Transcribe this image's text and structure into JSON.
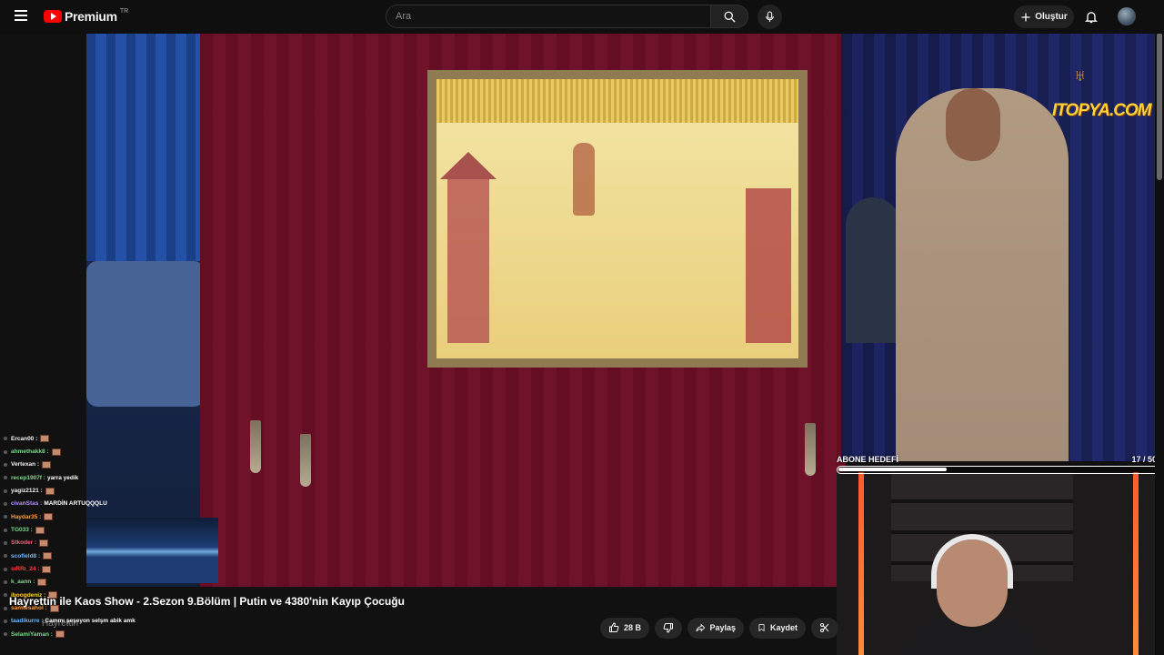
{
  "header": {
    "logo_text": "Premium",
    "region": "TR",
    "search_placeholder": "Ara",
    "create_label": "Oluştur",
    "icons": [
      "menu-icon",
      "search-icon",
      "mic-icon",
      "plus-icon",
      "bell-icon"
    ]
  },
  "overlay": {
    "brand": "ITOPYA.COM",
    "sub_goal": {
      "label": "ABONE HEDEFİ",
      "current": 17,
      "target": 50,
      "count_text": "17  / 50"
    }
  },
  "chat": [
    {
      "user": "Ercan00 :",
      "message": "",
      "color": "#f2f2f2"
    },
    {
      "user": "ahmethakk8 :",
      "message": "",
      "color": "#7cd88a"
    },
    {
      "user": "Vertexan :",
      "message": "",
      "color": "#f2f2f2"
    },
    {
      "user": "recep1907f :",
      "message": "yarra yedik",
      "color": "#7cd88a"
    },
    {
      "user": "yagiz2121 :",
      "message": "",
      "color": "#f2f2f2"
    },
    {
      "user": "civanStas :",
      "message": "MARDİN ARTUQQQLU",
      "color": "#b88cff"
    },
    {
      "user": "Haydar35 :",
      "message": "",
      "color": "#ff9e3d"
    },
    {
      "user": "TG033 :",
      "message": "",
      "color": "#7cd88a"
    },
    {
      "user": "Stkoder :",
      "message": "",
      "color": "#ff5a7a"
    },
    {
      "user": "scofield8 :",
      "message": "",
      "color": "#6fb7ff"
    },
    {
      "user": "sıRRı_24 :",
      "message": "",
      "color": "#ff3b3b"
    },
    {
      "user": "k_aann :",
      "message": "",
      "color": "#7cd88a"
    },
    {
      "user": "iboogdeniz :",
      "message": "",
      "color": "#ffd23a"
    },
    {
      "user": "samtesahol :",
      "message": "",
      "color": "#ff9e3d"
    },
    {
      "user": "taadikurre :",
      "message": "Cammı şeşeyon selşm abik amk",
      "color": "#6fb7ff"
    },
    {
      "user": "SelamiYaman :",
      "message": "",
      "color": "#7cd88a"
    }
  ],
  "video": {
    "title": "Hayrettin ile Kaos Show - 2.Sezon 9.Bölüm | Putin ve 4380'nin Kayıp Çocuğu",
    "channel": "Hayrettin",
    "likes": "28 B",
    "share_label": "Paylaş",
    "save_label": "Kaydet"
  }
}
